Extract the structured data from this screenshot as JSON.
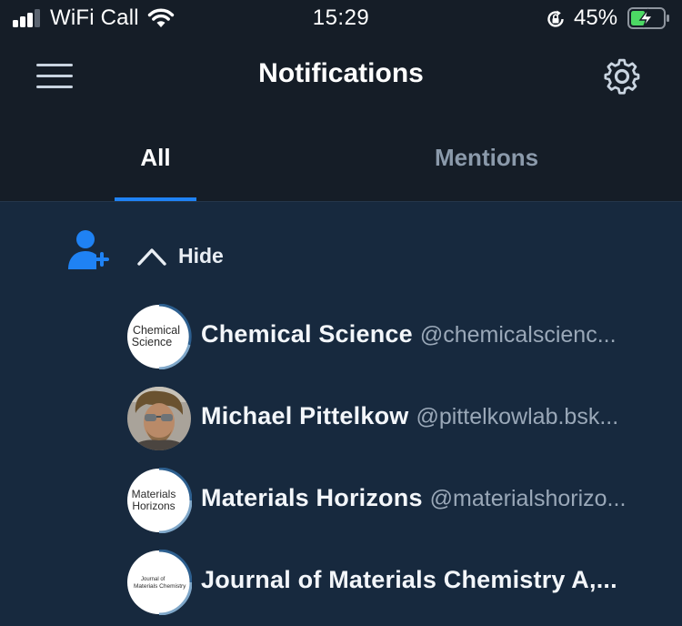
{
  "status_bar": {
    "carrier": "WiFi Call",
    "time": "15:29",
    "battery_percent": "45%",
    "battery_level": 0.45,
    "signal_bars_active": 3,
    "icons": [
      "signal-icon",
      "wifi-icon",
      "rotation-lock-icon",
      "battery-charging-icon"
    ]
  },
  "header": {
    "title": "Notifications",
    "menu_icon": "hamburger-menu-icon",
    "settings_icon": "gear-icon"
  },
  "tabs": [
    {
      "label": "All",
      "active": true
    },
    {
      "label": "Mentions",
      "active": false
    }
  ],
  "notification": {
    "icon": "person-add-icon",
    "toggle_label": "Hide",
    "toggle_icon": "chevron-up-icon",
    "users": [
      {
        "name": "Chemical Science",
        "handle": "@chemicalscienc...",
        "avatar_text": [
          "Chemical",
          "Science"
        ]
      },
      {
        "name": "Michael Pittelkow",
        "handle": "@pittelkowlab.bsk...",
        "avatar_text": []
      },
      {
        "name": "Materials Horizons",
        "handle": "@materialshorizo...",
        "avatar_text": [
          "Materials",
          "Horizons"
        ]
      },
      {
        "name": "Journal of Materials Chemistry A,...",
        "handle": "",
        "avatar_text": [
          "Journal of",
          "Materials Chemistry"
        ]
      }
    ]
  },
  "colors": {
    "header_bg": "#151d27",
    "content_bg": "#17293e",
    "accent": "#1f82f4",
    "muted_text": "#9aa8b8",
    "battery_charge": "#4cd964"
  }
}
